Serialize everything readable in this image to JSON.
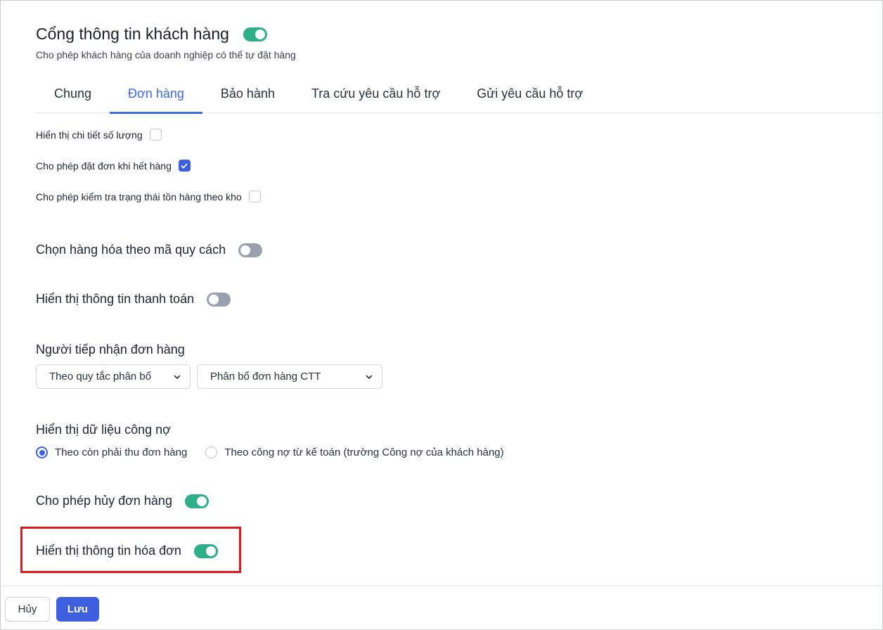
{
  "header": {
    "title": "Cổng thông tin khách hàng",
    "title_toggle_on": true,
    "subtitle": "Cho phép khách hàng của doanh nghiệp có thể tự đặt hàng"
  },
  "tabs": [
    {
      "label": "Chung",
      "active": false
    },
    {
      "label": "Đơn hàng",
      "active": true
    },
    {
      "label": "Bảo hành",
      "active": false
    },
    {
      "label": "Tra cứu yêu cầu hỗ trợ",
      "active": false
    },
    {
      "label": "Gửi yêu cầu hỗ trợ",
      "active": false
    }
  ],
  "checkboxes": [
    {
      "label": "Hiển thị chi tiết số lượng",
      "checked": false
    },
    {
      "label": "Cho phép đặt đơn khi hết hàng",
      "checked": true
    },
    {
      "label": "Cho phép kiểm tra trạng thái tồn hàng theo kho",
      "checked": false
    }
  ],
  "toggles": {
    "select_by_spec": {
      "label": "Chọn hàng hóa theo mã quy cách",
      "on": false
    },
    "show_payment": {
      "label": "Hiển thị thông tin thanh toán",
      "on": false
    },
    "allow_cancel": {
      "label": "Cho phép hủy đơn hàng",
      "on": true
    },
    "show_invoice": {
      "label": "Hiển thị thông tin hóa đơn",
      "on": true
    }
  },
  "order_receiver": {
    "label": "Người tiếp nhận đơn hàng",
    "rule_select": "Theo quy tắc phân bổ",
    "allocation_select": "Phân bổ đơn hàng CTT"
  },
  "debt_display": {
    "label": "Hiển thị dữ liệu công nợ",
    "options": [
      {
        "label": "Theo còn phải thu đơn hàng",
        "selected": true
      },
      {
        "label": "Theo công nợ từ kế toán (trường Công nợ của khách hàng)",
        "selected": false
      }
    ]
  },
  "footer": {
    "cancel_label": "Hủy",
    "save_label": "Lưu"
  },
  "colors": {
    "accent": "#3d6ce7",
    "toggle_on": "#2fae8a",
    "toggle_off": "#9aa0ad",
    "highlight": "#e0191c"
  }
}
